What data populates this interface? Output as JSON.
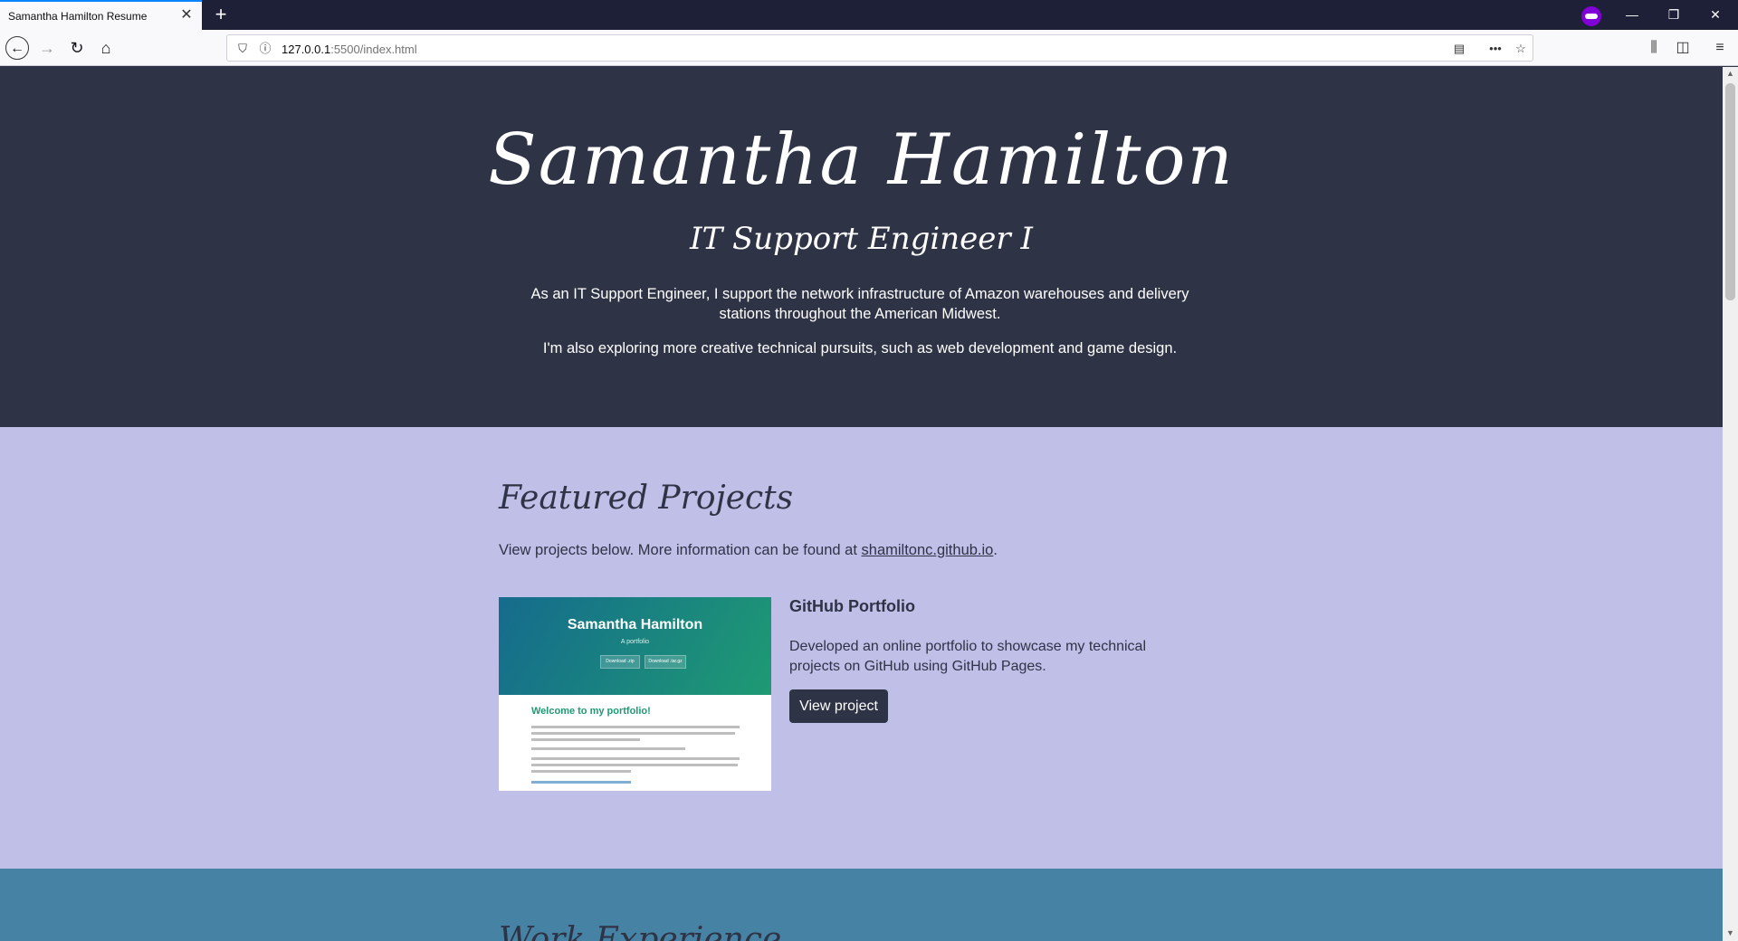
{
  "browser": {
    "tab_title": "Samantha Hamilton Resume",
    "tab_close": "✕",
    "new_tab": "+",
    "url_host": "127.0.0.1",
    "url_path": ":5500/index.html",
    "window_buttons": [
      "—",
      "❐",
      "✕"
    ]
  },
  "hero": {
    "name": "Samantha Hamilton",
    "title": "IT Support Engineer I",
    "paragraph1": "As an IT Support Engineer, I support the network infrastructure of Amazon warehouses and delivery stations throughout the American Midwest.",
    "paragraph2": "I'm also exploring more creative technical pursuits, such as web development and game design."
  },
  "projects": {
    "heading": "Featured Projects",
    "intro_text": "View projects below. More information can be found at ",
    "intro_link": "shamiltonc.github.io",
    "intro_end": ".",
    "items": [
      {
        "title": "GitHub Portfolio",
        "description": "Developed an online portfolio to showcase my technical projects on GitHub using GitHub Pages.",
        "button": "View project",
        "thumbnail": {
          "name": "Samantha Hamilton",
          "subtitle": "A portfolio",
          "btn1": "Download .zip",
          "btn2": "Download .tar.gz",
          "welcome": "Welcome to my portfolio!"
        }
      }
    ]
  },
  "work": {
    "heading": "Work Experience"
  }
}
